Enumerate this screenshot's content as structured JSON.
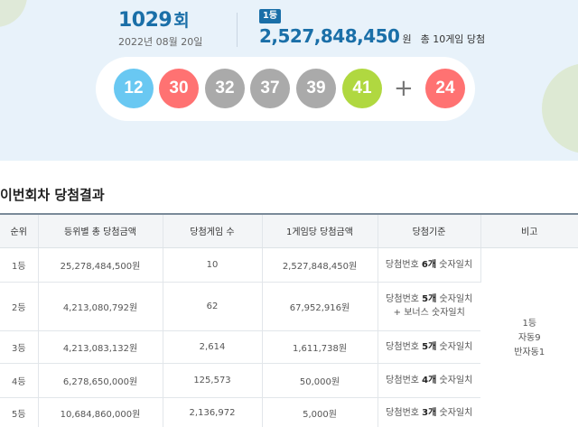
{
  "draw": {
    "number": "1029",
    "suffix": "회",
    "date": "2022년 08월 20일"
  },
  "first_prize": {
    "badge": "1등",
    "amount": "2,527,848,450",
    "unit": "원",
    "winners_text": "총 10게임 당첨"
  },
  "balls": {
    "main": [
      {
        "value": "12",
        "color": "#69c8f2"
      },
      {
        "value": "30",
        "color": "#ff7272"
      },
      {
        "value": "32",
        "color": "#aaaaaa"
      },
      {
        "value": "37",
        "color": "#aaaaaa"
      },
      {
        "value": "39",
        "color": "#aaaaaa"
      },
      {
        "value": "41",
        "color": "#b0d840"
      }
    ],
    "plus": "+",
    "bonus": {
      "value": "24",
      "color": "#ff7272"
    }
  },
  "section_title": "이번회차 당첨결과",
  "table": {
    "headers": [
      "순위",
      "등위별 총 당첨금액",
      "당첨게임 수",
      "1게임당 당첨금액",
      "당첨기준",
      "비고"
    ],
    "rows": [
      {
        "rank": "1등",
        "total": "25,278,484,500원",
        "games": "10",
        "per_game": "2,527,848,450원",
        "criteria": {
          "pre": "당첨번호 ",
          "count": "6개",
          "post": " 숫자일치",
          "extra": ""
        }
      },
      {
        "rank": "2등",
        "total": "4,213,080,792원",
        "games": "62",
        "per_game": "67,952,916원",
        "criteria": {
          "pre": "당첨번호 ",
          "count": "5개",
          "post": " 숫자일치",
          "extra": "+ 보너스 숫자일치"
        }
      },
      {
        "rank": "3등",
        "total": "4,213,083,132원",
        "games": "2,614",
        "per_game": "1,611,738원",
        "criteria": {
          "pre": "당첨번호 ",
          "count": "5개",
          "post": " 숫자일치",
          "extra": ""
        }
      },
      {
        "rank": "4등",
        "total": "6,278,650,000원",
        "games": "125,573",
        "per_game": "50,000원",
        "criteria": {
          "pre": "당첨번호 ",
          "count": "4개",
          "post": " 숫자일치",
          "extra": ""
        }
      },
      {
        "rank": "5등",
        "total": "10,684,860,000원",
        "games": "2,136,972",
        "per_game": "5,000원",
        "criteria": {
          "pre": "당첨번호 ",
          "count": "3개",
          "post": " 숫자일치",
          "extra": ""
        }
      }
    ],
    "note": {
      "line1": "1등",
      "line2": "자동9",
      "line3": "반자동1"
    }
  }
}
